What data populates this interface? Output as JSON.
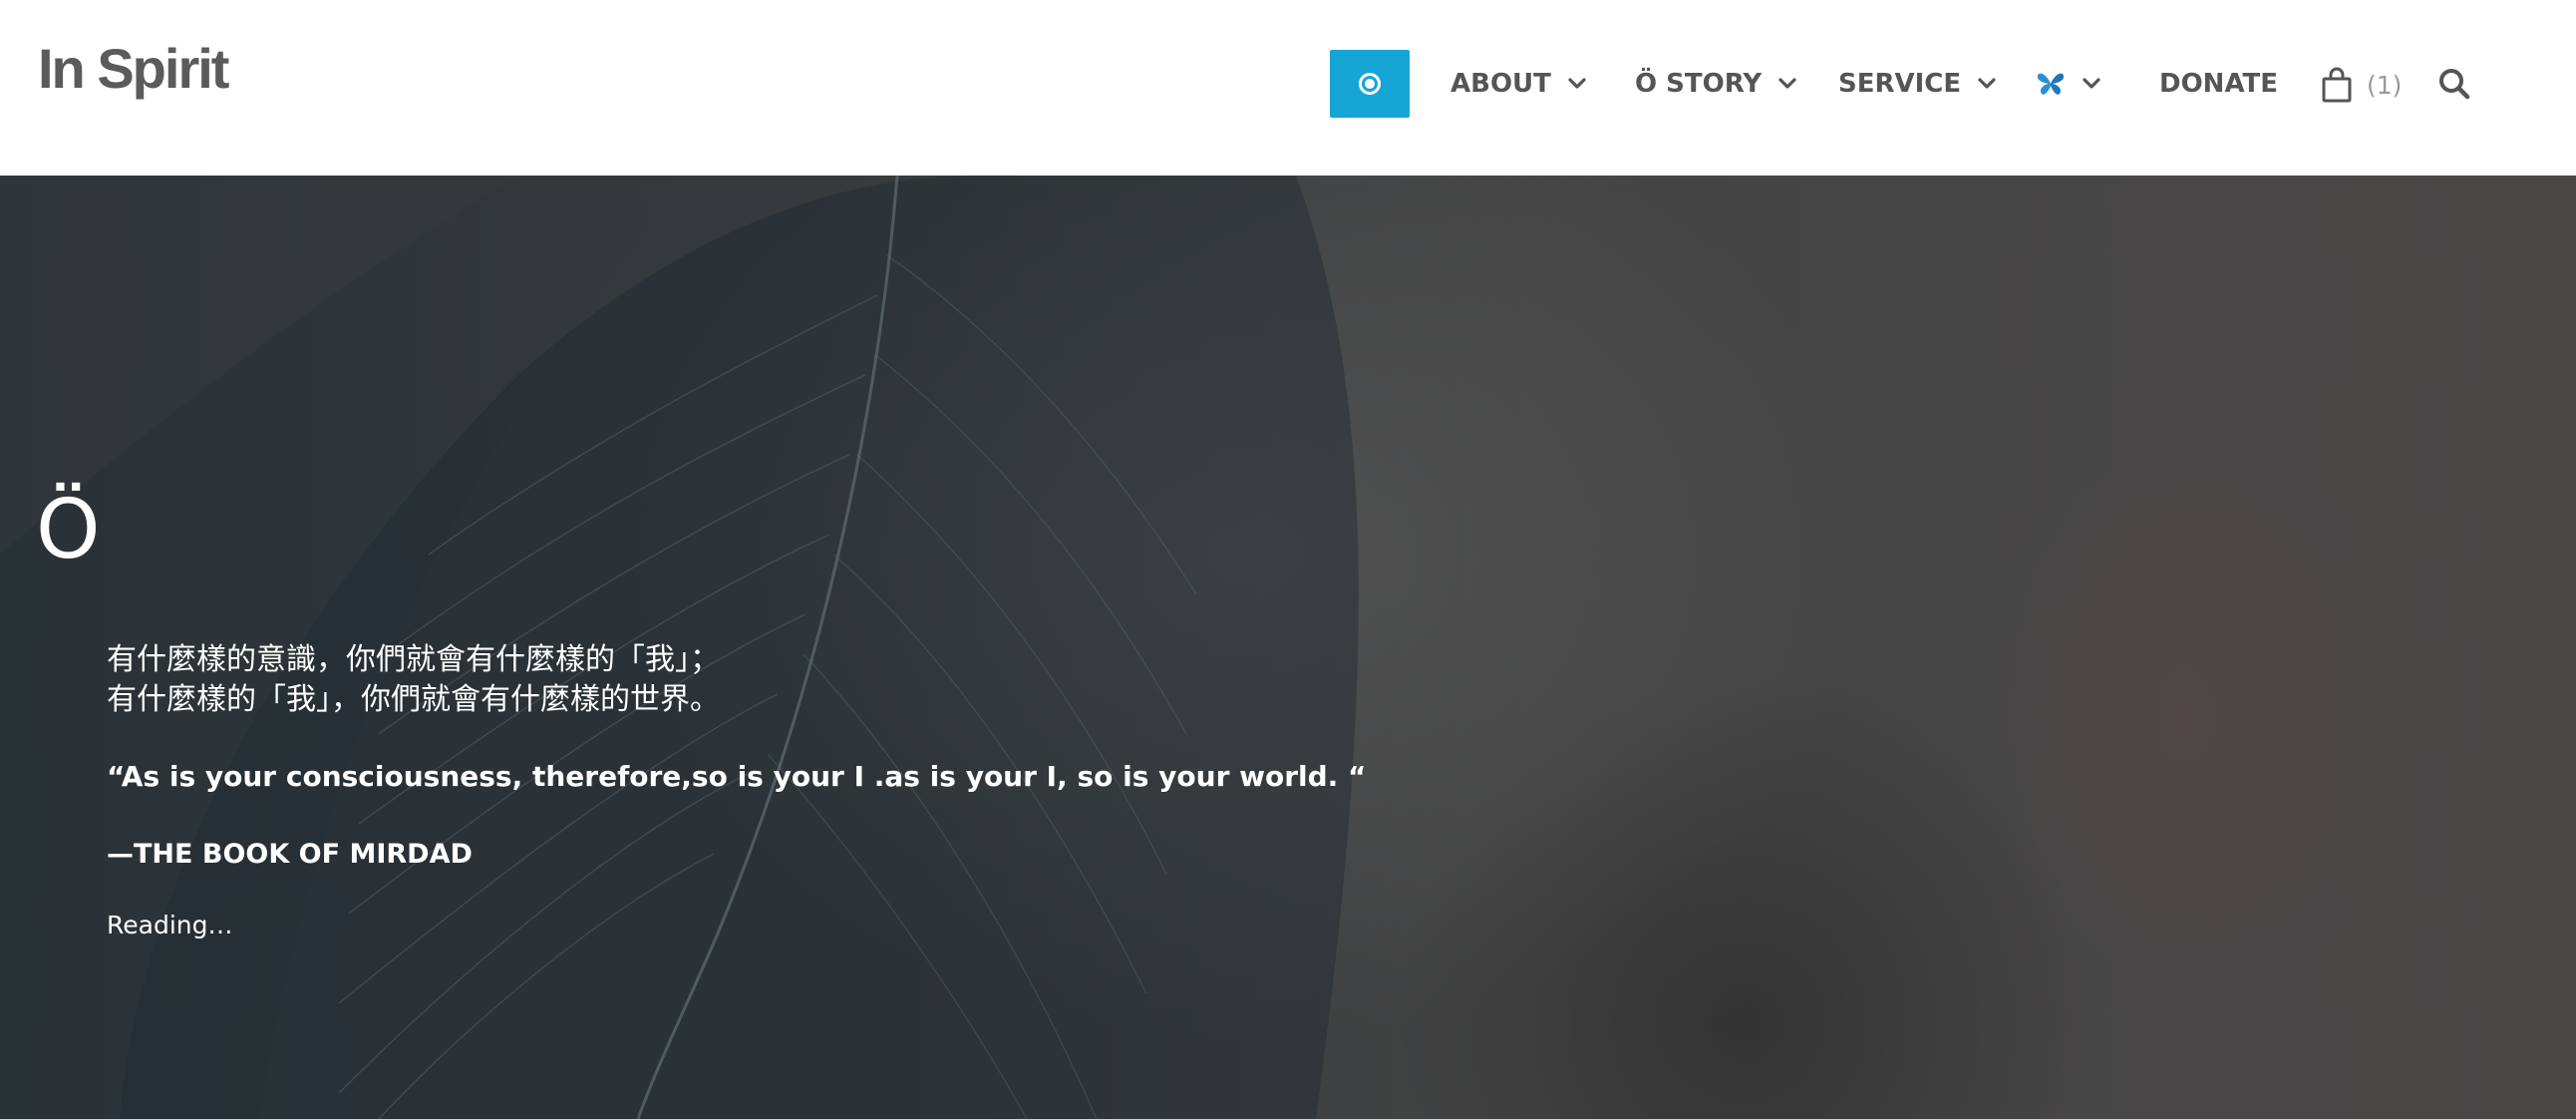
{
  "site": {
    "name": "In Spirit"
  },
  "nav": {
    "home_icon": "home-dot-icon",
    "items": [
      {
        "label": "ABOUT",
        "has_dropdown": true
      },
      {
        "label": "Ö STORY",
        "has_dropdown": true
      },
      {
        "label": "SERVICE",
        "has_dropdown": true
      },
      {
        "label": "",
        "icon": "butterfly-icon",
        "has_dropdown": true
      },
      {
        "label": "DONATE",
        "has_dropdown": false
      }
    ],
    "cart_count": "(1)",
    "search_icon": "search-icon"
  },
  "hero": {
    "mark": "Ö",
    "zh_lines": [
      "有什麼樣的意識，你們就會有什麼樣的「我」；",
      "有什麼樣的「我」，你們就會有什麼樣的世界。"
    ],
    "en_quote": "“As is your consciousness, therefore,so is your I .as is your I, so is your world. “",
    "attribution": "—THE BOOK OF MIRDAD",
    "reading_link": "Reading…"
  },
  "colors": {
    "accent": "#16a6d6",
    "nav_text": "#555555",
    "logo": "#5b5b5b",
    "butterfly": "#2a8fd0"
  }
}
